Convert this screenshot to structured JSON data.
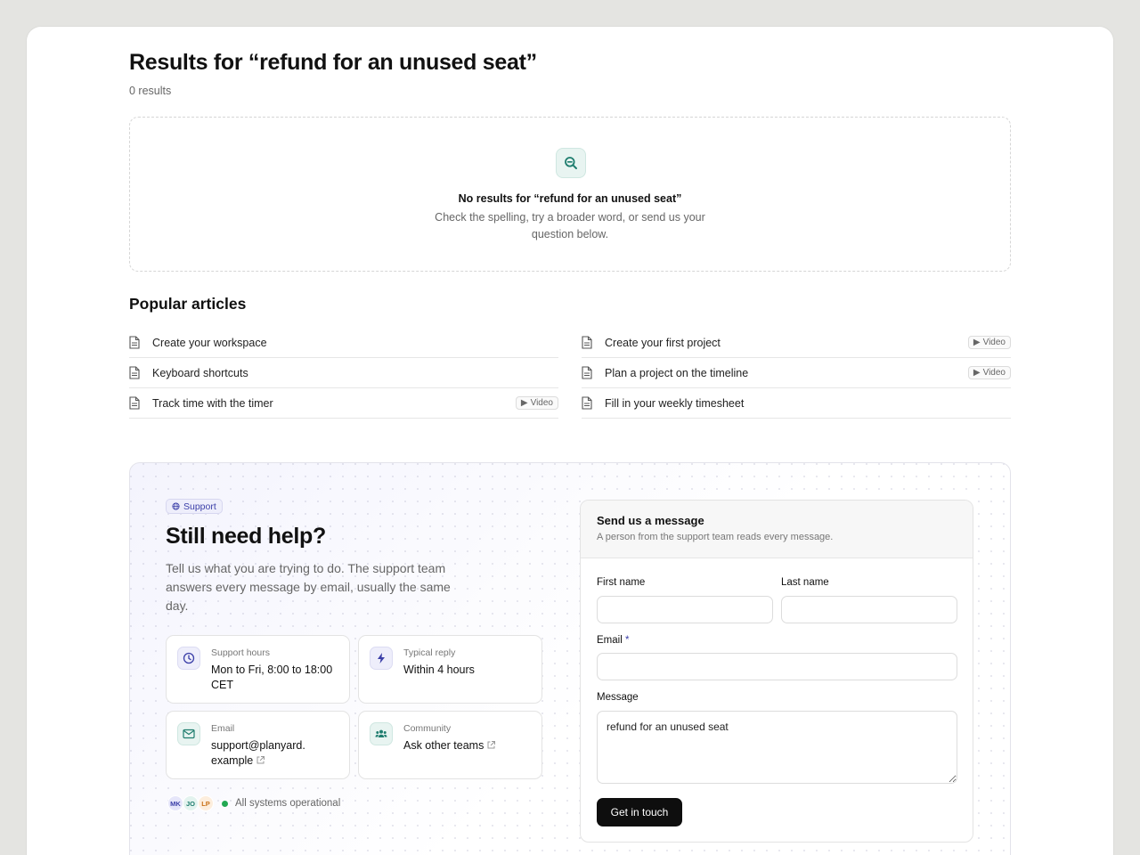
{
  "search": {
    "title": "Results for “refund for an unused seat”",
    "result_count": "0 results",
    "empty_title": "No results for “refund for an unused seat”",
    "empty_description": "Check the spelling, try a broader word, or send us your question below."
  },
  "popular": {
    "title": "Popular articles",
    "video_label": "Video",
    "left": [
      {
        "label": "Create your workspace",
        "video": false
      },
      {
        "label": "Keyboard shortcuts",
        "video": false
      },
      {
        "label": "Track time with the timer",
        "video": true
      }
    ],
    "right": [
      {
        "label": "Create your first project",
        "video": true
      },
      {
        "label": "Plan a project on the timeline",
        "video": true
      },
      {
        "label": "Fill in your weekly timesheet",
        "video": false
      }
    ]
  },
  "help": {
    "badge": "Support",
    "title": "Still need help?",
    "description": "Tell us what you are trying to do. The support team answers every message by email, usually the same day.",
    "cards": [
      {
        "label": "Support hours",
        "value": "Mon to Fri, 8:00 to 18:00 CET",
        "icon": "clock-icon"
      },
      {
        "label": "Typical reply",
        "value": "Within 4 hours",
        "icon": "bolt-icon"
      },
      {
        "label": "Email",
        "value": "support@planyard. example",
        "icon": "mail-icon"
      },
      {
        "label": "Community",
        "value": "Ask other teams",
        "icon": "people-icon"
      }
    ],
    "avatars": [
      "MK",
      "JO",
      "LP"
    ],
    "status": "All systems operational"
  },
  "form": {
    "title": "Send us a message",
    "subtitle": "A person from the support team reads every message.",
    "first_name_label": "First name",
    "last_name_label": "Last name",
    "email_label": "Email",
    "required_marker": "*",
    "message_label": "Message",
    "message_value": "refund for an unused seat",
    "first_name_value": "",
    "last_name_value": "",
    "email_value": "",
    "submit_label": "Get in touch"
  },
  "colors": {
    "accent": "#3b3fa8",
    "teal": "#1e7d6e",
    "status_green": "#22a852",
    "button_dark": "#0e0e0e"
  }
}
